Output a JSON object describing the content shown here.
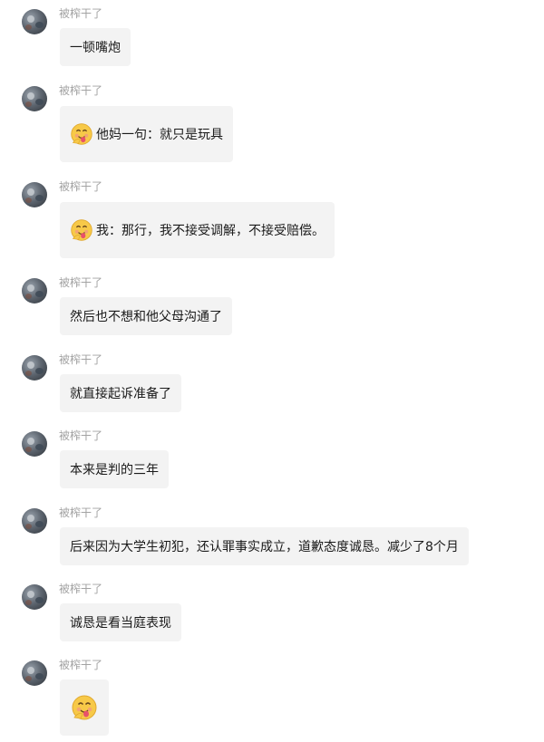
{
  "messages": [
    {
      "sender": "被榨干了",
      "text": "一顿嘴炮",
      "emoji": ""
    },
    {
      "sender": "被榨干了",
      "text": "他妈一句：就只是玩具",
      "emoji": "tongue-emoji"
    },
    {
      "sender": "被榨干了",
      "text": "我：那行，我不接受调解，不接受赔偿。",
      "emoji": "tongue-emoji"
    },
    {
      "sender": "被榨干了",
      "text": "然后也不想和他父母沟通了",
      "emoji": ""
    },
    {
      "sender": "被榨干了",
      "text": "就直接起诉准备了",
      "emoji": ""
    },
    {
      "sender": "被榨干了",
      "text": "本来是判的三年",
      "emoji": ""
    },
    {
      "sender": "被榨干了",
      "text": "后来因为大学生初犯，还认罪事实成立，道歉态度诚恳。减少了8个月",
      "emoji": ""
    },
    {
      "sender": "被榨干了",
      "text": "诚恳是看当庭表现",
      "emoji": ""
    },
    {
      "sender": "被榨干了",
      "text": "",
      "emoji": "tongue-emoji"
    }
  ],
  "colors": {
    "bubble": "#f3f3f3",
    "name": "#a3a3a3",
    "text": "#1a1a1a",
    "background": "#ffffff"
  }
}
